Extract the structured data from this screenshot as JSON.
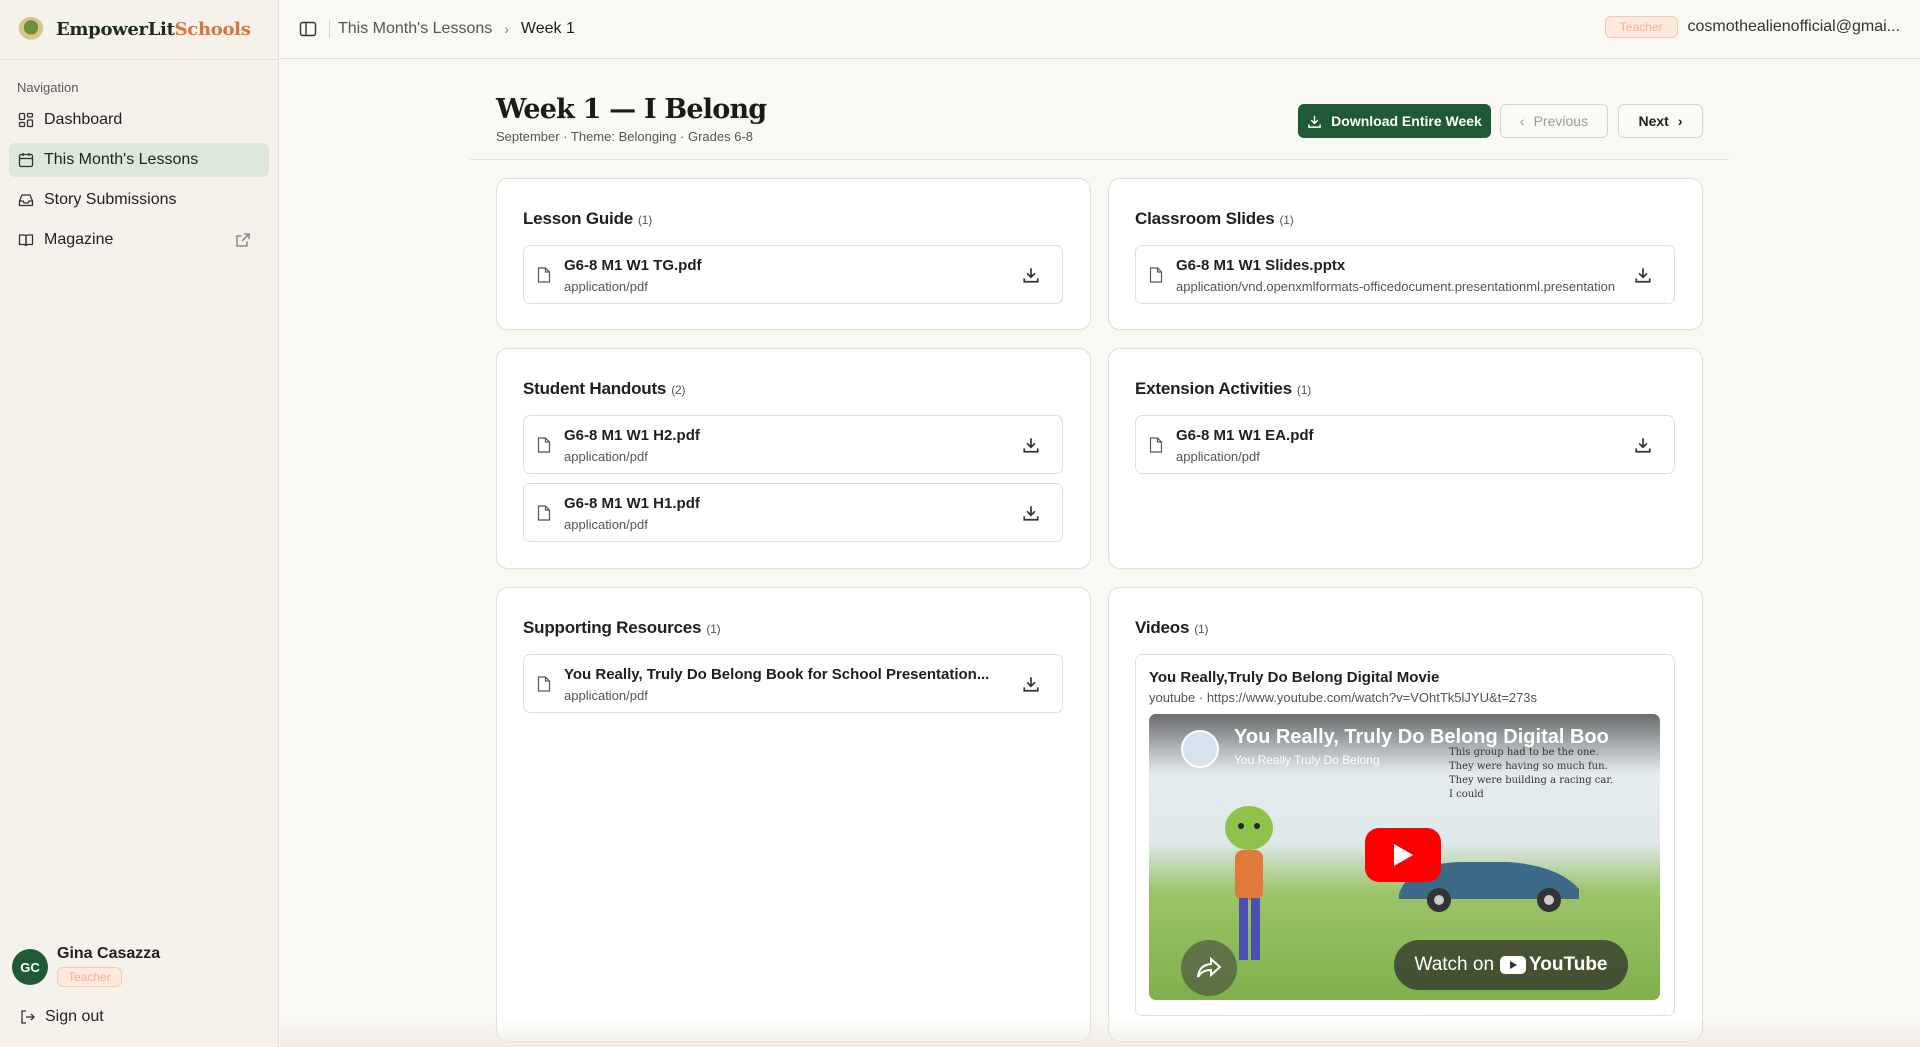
{
  "brand": {
    "name_part1": "EmpowerLit",
    "name_part2": "Schools"
  },
  "sidebar": {
    "heading": "Navigation",
    "items": [
      {
        "label": "Dashboard",
        "icon": "dashboard-icon"
      },
      {
        "label": "This Month's Lessons",
        "icon": "calendar-icon",
        "active": true
      },
      {
        "label": "Story Submissions",
        "icon": "inbox-icon"
      },
      {
        "label": "Magazine",
        "icon": "book-icon",
        "external": true
      }
    ],
    "user": {
      "initials": "GC",
      "name": "Gina Casazza",
      "role": "Teacher"
    },
    "signout_label": "Sign out"
  },
  "topbar": {
    "breadcrumb": [
      "This Month's Lessons",
      "Week 1"
    ],
    "role": "Teacher",
    "email": "cosmothealienofficial@gmai..."
  },
  "header": {
    "title": "Week 1 — I Belong",
    "subtitle": "September · Theme: Belonging · Grades 6-8",
    "download_label": "Download Entire Week",
    "prev_label": "Previous",
    "next_label": "Next"
  },
  "sections": {
    "lesson_guide": {
      "title": "Lesson Guide",
      "count": "(1)",
      "files": [
        {
          "name": "G6-8 M1 W1 TG.pdf",
          "type": "application/pdf"
        }
      ]
    },
    "classroom_slides": {
      "title": "Classroom Slides",
      "count": "(1)",
      "files": [
        {
          "name": "G6-8 M1 W1 Slides.pptx",
          "type": "application/vnd.openxmlformats-officedocument.presentationml.presentation"
        }
      ]
    },
    "student_handouts": {
      "title": "Student Handouts",
      "count": "(2)",
      "files": [
        {
          "name": "G6-8 M1 W1 H2.pdf",
          "type": "application/pdf"
        },
        {
          "name": "G6-8 M1 W1 H1.pdf",
          "type": "application/pdf"
        }
      ]
    },
    "extension_activities": {
      "title": "Extension Activities",
      "count": "(1)",
      "files": [
        {
          "name": "G6-8 M1 W1 EA.pdf",
          "type": "application/pdf"
        }
      ]
    },
    "supporting_resources": {
      "title": "Supporting Resources",
      "count": "(1)",
      "files": [
        {
          "name": "You Really, Truly Do Belong Book for School Presentation...",
          "type": "application/pdf"
        }
      ]
    },
    "videos": {
      "title": "Videos",
      "count": "(1)",
      "video": {
        "title": "You Really,Truly Do Belong Digital Movie",
        "meta": "youtube · https://www.youtube.com/watch?v=VOhtTk5lJYU&t=273s",
        "embed_heading": "You Really, Truly Do Belong Digital Boo",
        "embed_channel": "You Really Truly Do Belong",
        "embed_caption": [
          "This group had to be the one.",
          "They were having so much fun.",
          "They were building a racing car.",
          "I could"
        ],
        "watch_label": "Watch on",
        "youtube_label": "YouTube"
      }
    }
  },
  "colors": {
    "primary": "#1f5a34",
    "accent": "#d9743a",
    "active_nav": "#dce9da",
    "play": "#ff0000"
  }
}
